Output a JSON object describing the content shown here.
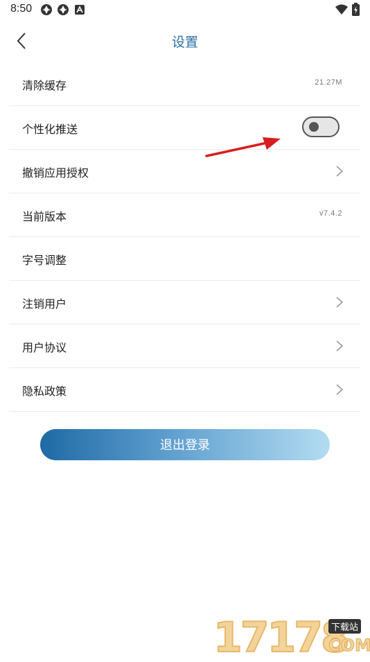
{
  "status_bar": {
    "time": "8:50",
    "left_icons": [
      "vpn-icon",
      "vpn-icon",
      "notification-a-icon"
    ],
    "right_icons": [
      "wifi-icon",
      "battery-charging-icon"
    ]
  },
  "header": {
    "title": "设置"
  },
  "settings": {
    "items": [
      {
        "label": "清除缓存",
        "value": "21.27M",
        "control": "value"
      },
      {
        "label": "个性化推送",
        "control": "toggle",
        "toggle_on": false
      },
      {
        "label": "撤销应用授权",
        "control": "chevron"
      },
      {
        "label": "当前版本",
        "value": "v7.4.2",
        "control": "value"
      },
      {
        "label": "字号调整",
        "control": "none"
      },
      {
        "label": "注销用户",
        "control": "chevron"
      },
      {
        "label": "用户协议",
        "control": "chevron"
      },
      {
        "label": "隐私政策",
        "control": "chevron"
      }
    ]
  },
  "logout": {
    "label": "退出登录"
  },
  "watermark": {
    "digits": "17178",
    "badge": "下载站",
    "domain": "COM"
  },
  "colors": {
    "title": "#2a6fa3",
    "button_start": "#1f6aa5",
    "button_end": "#b3dcf1",
    "annotation_arrow": "#d81e1e"
  }
}
